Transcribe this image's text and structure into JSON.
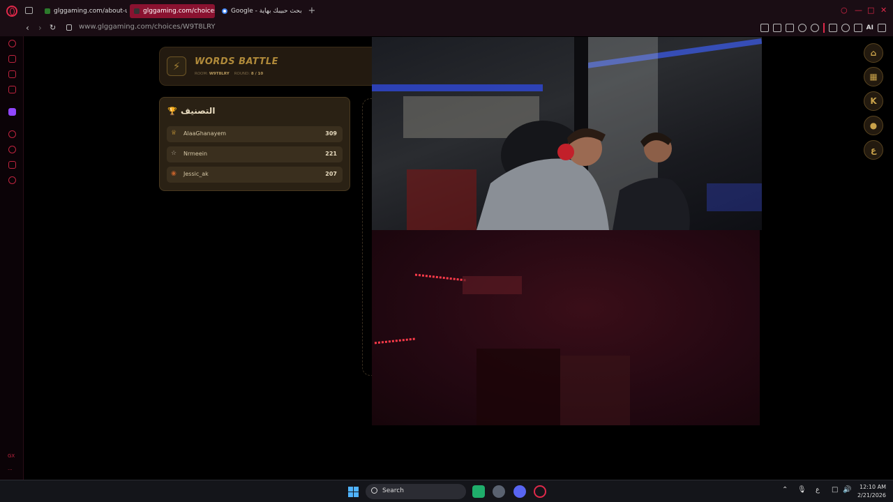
{
  "browser": {
    "tabs": [
      {
        "label": "glggaming.com/about-us",
        "active": false
      },
      {
        "label": "glggaming.com/choices/V",
        "active": true
      },
      {
        "label": "Google - بحث حبيبك بهاية",
        "active": false
      }
    ],
    "new_tab": "+",
    "url": "www.glggaming.com/choices/W9T8LRY",
    "ai_label": "AI",
    "accent": "#e0294a"
  },
  "game": {
    "title": "WORDS BATTLE",
    "room_label": "ROOM:",
    "room_code": "W9T8LRY",
    "round_label": "ROUND:",
    "round_value": "8 / 10"
  },
  "ranking": {
    "title": "التصنيف",
    "rows": [
      {
        "name": "AlaaGhanayem",
        "score": "309",
        "icon": "crown-icon"
      },
      {
        "name": "Nrmeein",
        "score": "221",
        "icon": "trophy-icon"
      },
      {
        "name": "Jessic_ak",
        "score": "207",
        "icon": "medal-icon"
      }
    ]
  },
  "right_panel": {
    "k_label": "K",
    "ar_label": "ع"
  },
  "sidebar": {
    "gx_label": "GX",
    "more_label": "···"
  },
  "taskbar": {
    "search_label": "Search",
    "lang": "ع",
    "time": "12:10 AM",
    "date": "2/21/2026"
  }
}
